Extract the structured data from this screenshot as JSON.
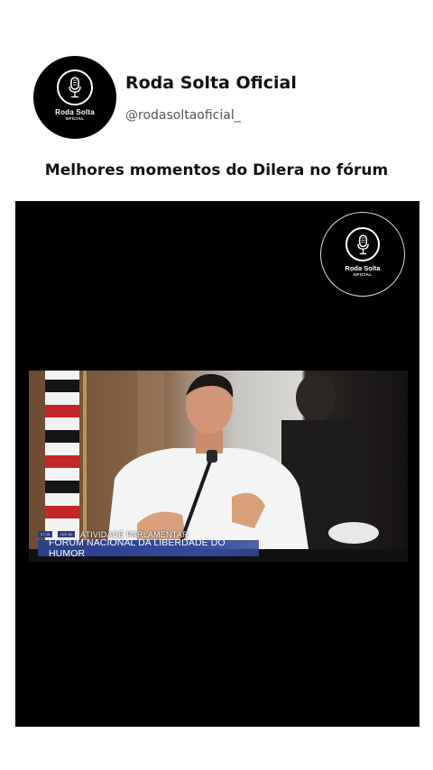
{
  "profile": {
    "name": "Roda Solta Oficial",
    "handle": "@rodasoltaoficial_",
    "avatar_brand_top": "Roda Solta",
    "avatar_brand_bottom": "OFICIAL"
  },
  "post": {
    "title": "Melhores momentos do Dilera no fórum"
  },
  "video": {
    "watermark_brand_top": "Roda Solta",
    "watermark_brand_bottom": "OFICIAL",
    "lower_third_section": "ATIVIDADE PARLAMENTAR",
    "lower_third_title": "FÓRUM NACIONAL DA LIBERDADE DO HUMOR",
    "lower_third_tiny_left": "07:08",
    "lower_third_tiny_right": "GO! 69"
  },
  "colors": {
    "background": "#ffffff",
    "video_background": "#000000",
    "lower_third_blue": "#2a3f86"
  },
  "icons": [
    "microphone-icon"
  ]
}
